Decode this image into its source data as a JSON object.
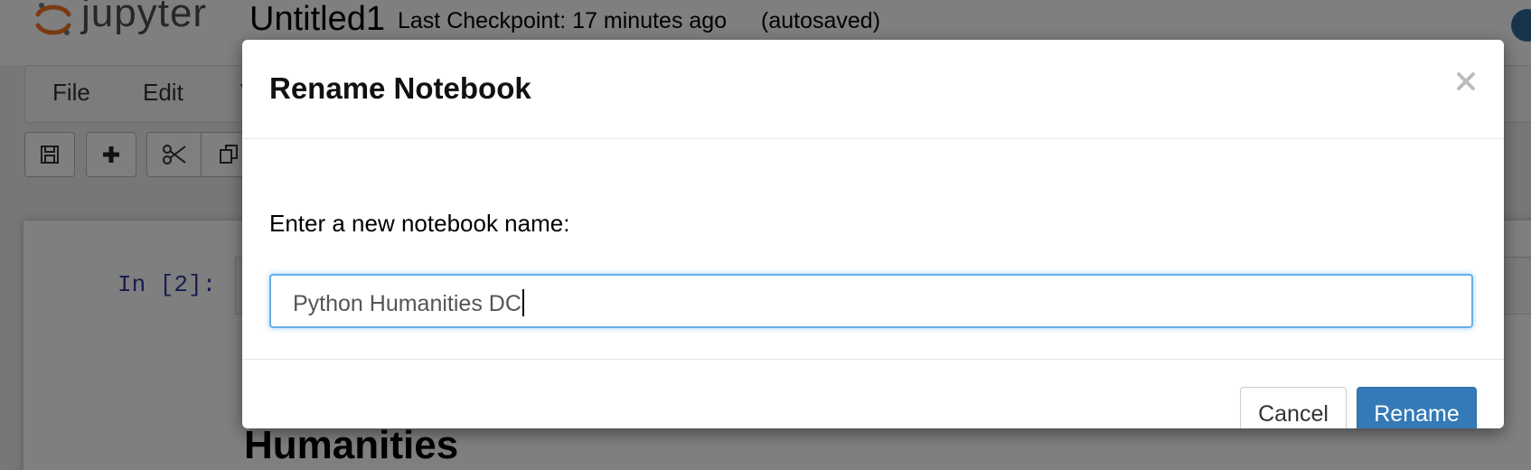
{
  "app": {
    "logo_text": "jupyter",
    "notebook_name": "Untitled1",
    "checkpoint": "Last Checkpoint: 17 minutes ago",
    "autosave_status": "(autosaved)"
  },
  "menu": {
    "items": [
      "File",
      "Edit",
      "V"
    ]
  },
  "toolbar": {
    "icons": [
      "save-icon",
      "plus-icon",
      "scissors-icon",
      "copy-icon"
    ]
  },
  "notebook": {
    "prompt": "In [2]:",
    "heading_fragment": "Humanities"
  },
  "modal": {
    "title": "Rename Notebook",
    "label": "Enter a new notebook name:",
    "input_value": "Python Humanities DC",
    "cancel_label": "Cancel",
    "rename_label": "Rename",
    "close_icon": "close-icon"
  },
  "colors": {
    "primary_button": "#337ab7",
    "input_focus_border": "#66afe9",
    "prompt_color": "#303f9f",
    "jupyter_orange": "#f37726"
  }
}
